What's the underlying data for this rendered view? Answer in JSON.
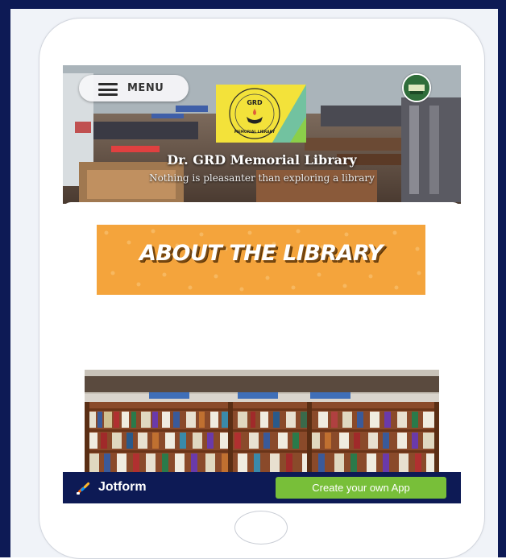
{
  "header": {
    "menu_label": "MENU",
    "avatar_icon": "user-avatar-icon"
  },
  "logo": {
    "text_top": "GRD",
    "text_bottom": "MEMORIAL LIBRARY"
  },
  "site": {
    "title": "Dr. GRD Memorial Library",
    "tagline": "Nothing is pleasanter than exploring a library"
  },
  "about": {
    "banner_text": "ABOUT THE LIBRARY"
  },
  "footer": {
    "brand_name": "Jotform",
    "cta_label": "Create your own App"
  },
  "colors": {
    "frame": "#0d1a55",
    "banner": "#f4a43c",
    "cta": "#78bf39",
    "footer_bar": "#0d1a55"
  }
}
